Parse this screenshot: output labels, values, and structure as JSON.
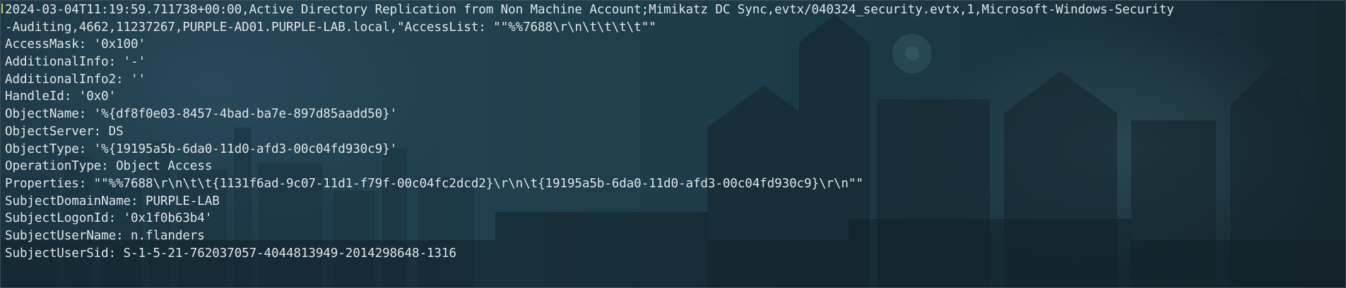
{
  "terminal": {
    "lines": [
      "2024-03-04T11:19:59.711738+00:00,Active Directory Replication from Non Machine Account;Mimikatz DC Sync,evtx/040324_security.evtx,1,Microsoft-Windows-Security",
      "-Auditing,4662,11237267,PURPLE-AD01.PURPLE-LAB.local,\"AccessList: \"\"%%7688\\r\\n\\t\\t\\t\\t\"\"",
      "AccessMask: '0x100'",
      "AdditionalInfo: '-'",
      "AdditionalInfo2: ''",
      "HandleId: '0x0'",
      "ObjectName: '%{df8f0e03-8457-4bad-ba7e-897d85aadd50}'",
      "ObjectServer: DS",
      "ObjectType: '%{19195a5b-6da0-11d0-afd3-00c04fd930c9}'",
      "OperationType: Object Access",
      "Properties: \"\"%%7688\\r\\n\\t\\t{1131f6ad-9c07-11d1-f79f-00c04fc2dcd2}\\r\\n\\t{19195a5b-6da0-11d0-afd3-00c04fd930c9}\\r\\n\"\"",
      "SubjectDomainName: PURPLE-LAB",
      "SubjectLogonId: '0x1f0b63b4'",
      "SubjectUserName: n.flanders",
      "SubjectUserSid: S-1-5-21-762037057-4044813949-2014298648-1316"
    ]
  }
}
